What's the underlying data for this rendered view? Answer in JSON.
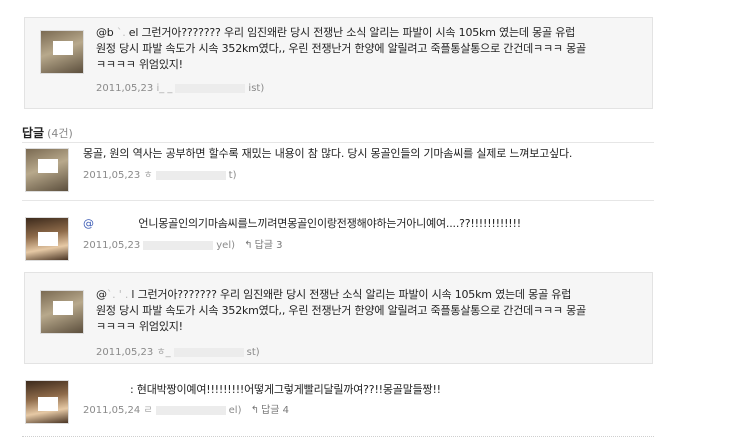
{
  "quote1": {
    "prefix": "@b",
    "text_line1": "el 그런거아??????? 우리 임진왜란 당시 전쟁난 소식 알리는 파발이 시속 105km 였는데 몽골 유럽",
    "text_line2": "원정 당시 파발 속도가 시속 352km였다,, 우린 전쟁난거 한양에 알릴려고 죽플통살통으로 간건데ㅋㅋㅋ 몽골",
    "text_line3": "ㅋㅋㅋㅋ 위엄있지!",
    "date": "2011,05,23",
    "meta_tail": "ist)"
  },
  "replies_heading": {
    "label": "답글",
    "count": "(4건)"
  },
  "comment1": {
    "text": "몽골, 원의 역사는 공부하면 할수록 재밌는 내용이 참 많다. 당시 몽골인들의 기마솜씨를 실제로 느껴보고싶다.",
    "date": "2011,05,23",
    "meta_tail": "t)"
  },
  "comment2": {
    "at": "@",
    "text": "언니몽골인의기마솜씨를느끼려면몽골인이랑전쟁해야하는거아니예여....??!!!!!!!!!!!!",
    "date": "2011,05,23",
    "meta_tail": "yel)",
    "reply_label": "답글 3"
  },
  "quote2": {
    "prefix": "@",
    "text_line1": "l 그런거아??????? 우리 임진왜란 당시 전쟁난 소식 알리는 파발이 시속 105km 였는데 몽골 유럽",
    "text_line2": "원정 당시 파발 속도가 시속 352km였다,, 우린 전쟁난거 한양에 알릴려고 죽플통살통으로 간건데ㅋㅋㅋ 몽골",
    "text_line3": "ㅋㅋㅋㅋ 위엄있지!",
    "date": "2011,05,23",
    "meta_tail": "st)"
  },
  "comment3": {
    "text": ": 현대박짱이예여!!!!!!!!!어떻게그렇게빨리달릴까여??!!몽골말들짱!!",
    "date": "2011,05,24",
    "meta_tail": "el)",
    "reply_label": "답글 4"
  }
}
